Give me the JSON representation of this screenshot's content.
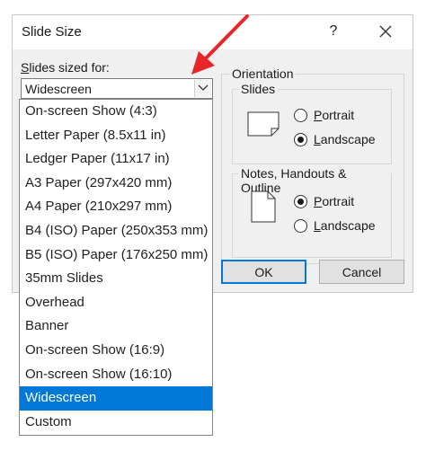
{
  "dialog": {
    "title": "Slide Size",
    "help_label": "?",
    "sized_for": {
      "label_underlined": "S",
      "label_rest": "lides sized for:",
      "value": "Widescreen"
    },
    "orientation": {
      "label": "Orientation",
      "slides": {
        "label": "Slides",
        "portrait_label": "Portrait",
        "portrait_underlined": "P",
        "landscape_label": "Landscape",
        "landscape_underlined": "L",
        "selected": "landscape"
      },
      "notes": {
        "label": "Notes, Handouts & Outline",
        "portrait_label": "Portrait",
        "portrait_underlined": "P",
        "landscape_label": "Landscape",
        "landscape_underlined": "L",
        "selected": "portrait"
      }
    },
    "ok_label": "OK",
    "cancel_label": "Cancel"
  },
  "dropdown": {
    "items": [
      "On-screen Show (4:3)",
      "Letter Paper (8.5x11 in)",
      "Ledger Paper (11x17 in)",
      "A3 Paper (297x420 mm)",
      "A4 Paper (210x297 mm)",
      "B4 (ISO) Paper (250x353 mm)",
      "B5 (ISO) Paper (176x250 mm)",
      "35mm Slides",
      "Overhead",
      "Banner",
      "On-screen Show (16:9)",
      "On-screen Show (16:10)",
      "Widescreen",
      "Custom"
    ],
    "selected_index": 12
  },
  "colors": {
    "accent": "#0078d7",
    "annotation_arrow": "#e8262a"
  }
}
